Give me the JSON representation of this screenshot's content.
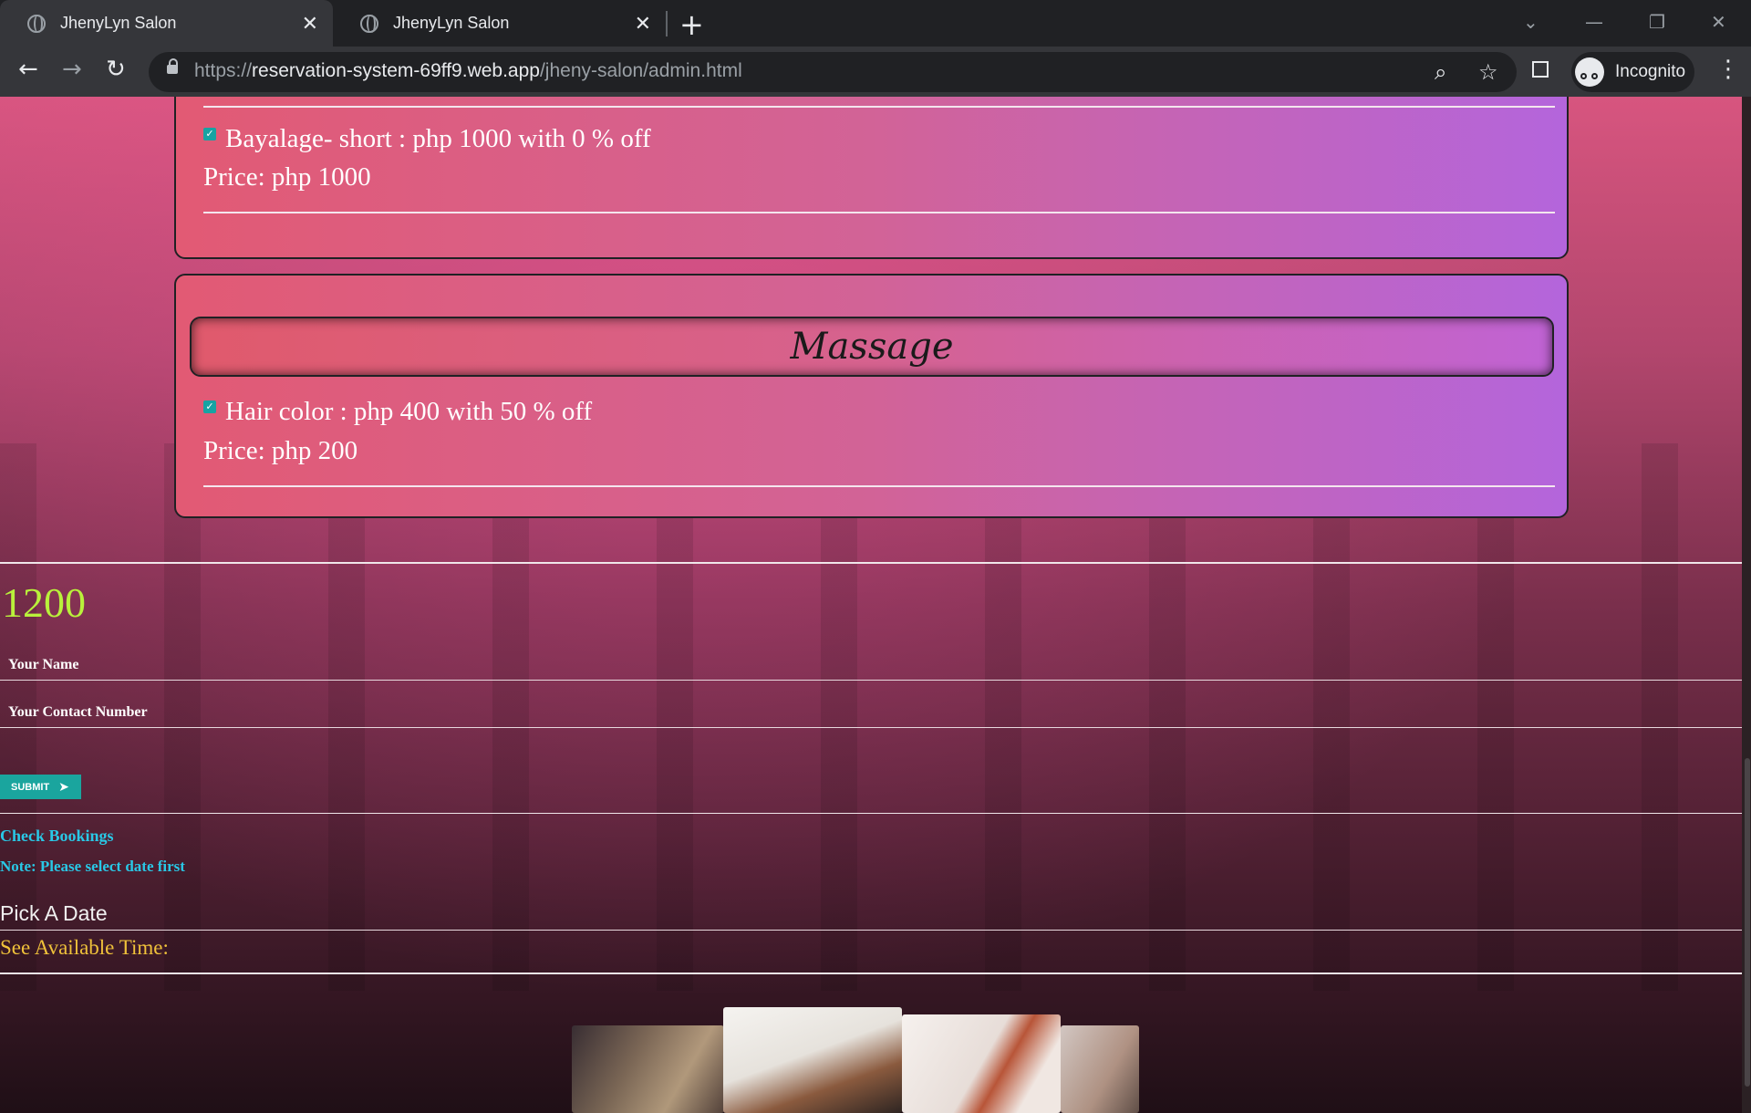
{
  "browser": {
    "tabs": [
      {
        "title": "JhenyLyn Salon",
        "active": true
      },
      {
        "title": "JhenyLyn Salon",
        "active": false
      }
    ],
    "url_scheme": "https://",
    "url_host": "reservation-system-69ff9.web.app",
    "url_path": "/jheny-salon/admin.html",
    "profile_label": "Incognito"
  },
  "services": {
    "card1": {
      "items": [
        {
          "label": "Bayalage- short : php 1000 with 0 % off",
          "price": "Price: php 1000",
          "checked": true
        }
      ]
    },
    "card2": {
      "category": "Massage",
      "items": [
        {
          "label": "Hair color : php 400 with 50 % off",
          "price": "Price: php 200",
          "checked": true
        }
      ]
    }
  },
  "booking": {
    "total": "1200",
    "name_label": "Your Name",
    "contact_label": "Your Contact Number",
    "submit_label": "SUBMIT",
    "check_bookings": "Check Bookings",
    "note": "Note: Please select date first",
    "pick_date": "Pick A Date",
    "available_time": "See Available Time:"
  },
  "colors": {
    "total": "#b9f13b",
    "submit_bg": "#1aa59e",
    "link": "#29c8e6",
    "available_time": "#f0c23a"
  }
}
